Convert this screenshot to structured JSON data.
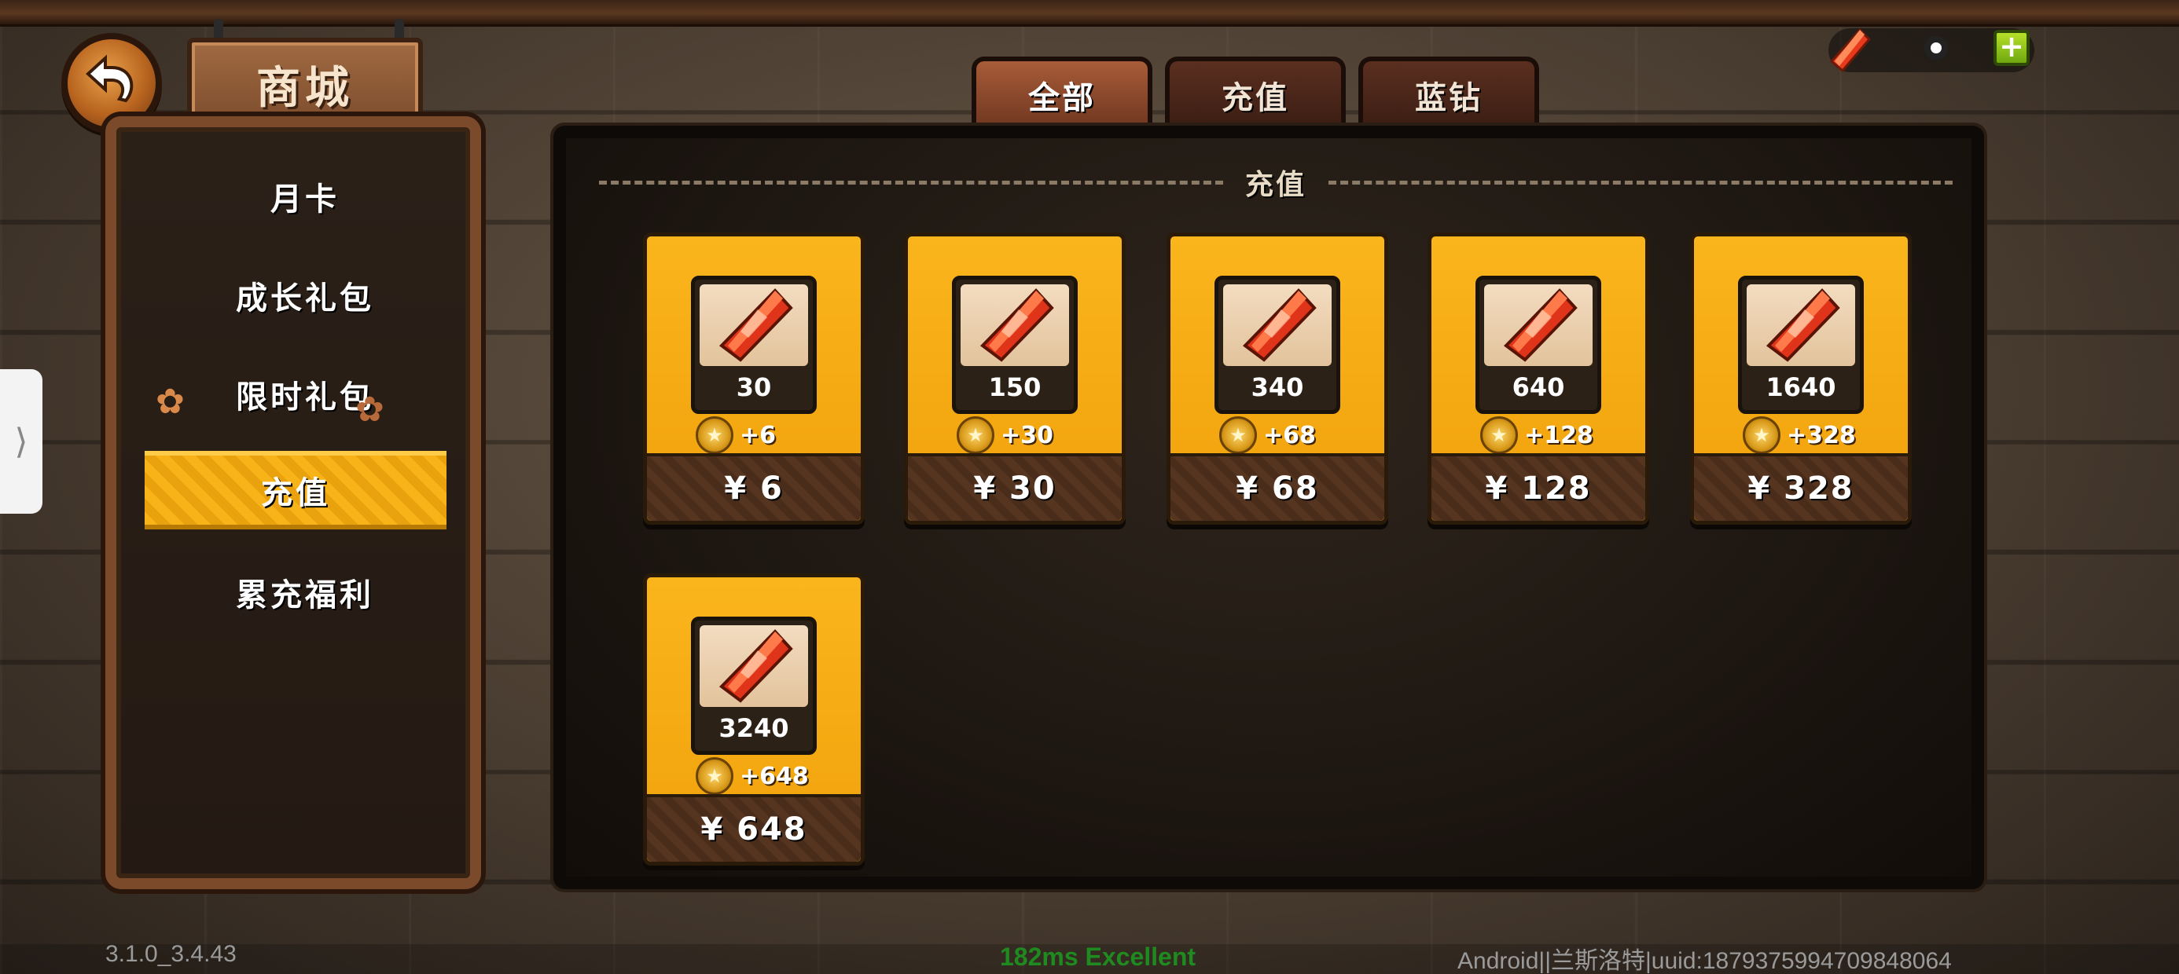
{
  "title": "商城",
  "sidebar": {
    "items": [
      {
        "label": "月卡"
      },
      {
        "label": "成长礼包"
      },
      {
        "label": "限时礼包"
      },
      {
        "label": "充值"
      },
      {
        "label": "累充福利"
      }
    ],
    "active_index": 3
  },
  "tabs": [
    {
      "label": "全部"
    },
    {
      "label": "充值"
    },
    {
      "label": "蓝钻"
    }
  ],
  "active_tab": 0,
  "section_title": "充值",
  "products": [
    {
      "amount": "30",
      "bonus": "+6",
      "price": "¥ 6"
    },
    {
      "amount": "150",
      "bonus": "+30",
      "price": "¥ 30"
    },
    {
      "amount": "340",
      "bonus": "+68",
      "price": "¥ 68"
    },
    {
      "amount": "640",
      "bonus": "+128",
      "price": "¥ 128"
    },
    {
      "amount": "1640",
      "bonus": "+328",
      "price": "¥ 328"
    },
    {
      "amount": "3240",
      "bonus": "+648",
      "price": "¥ 648"
    }
  ],
  "footer": {
    "version": "3.1.0_3.4.43",
    "ping": "182ms Excellent",
    "device": "Android||兰斯洛特|uuid:1879375994709848064"
  },
  "icons": {
    "back": "back-arrow-icon",
    "currency": "red-crystal-icon",
    "plus": "plus-icon",
    "bonus": "medal-icon",
    "product": "red-crystal-icon"
  },
  "colors": {
    "card": "#f7ad14",
    "active_item": "#f7b318",
    "ping": "#1f8a1f"
  }
}
